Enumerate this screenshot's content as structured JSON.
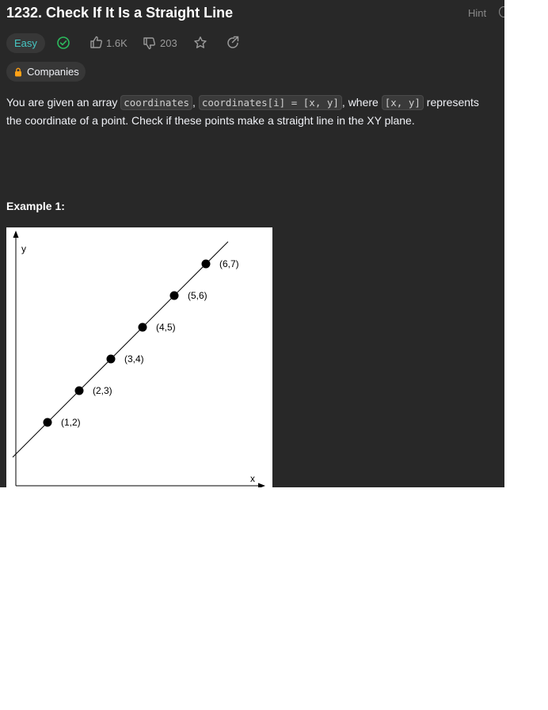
{
  "problem": {
    "title": "1232. Check If It Is a Straight Line",
    "hint_label": "Hint",
    "difficulty": "Easy",
    "likes": "1.6K",
    "dislikes": "203",
    "companies_label": "Companies",
    "colors": {
      "easy": "#46c6c2",
      "solved": "#2cbb5d",
      "panel_bg": "#282828"
    }
  },
  "description": {
    "text_1": "You are given an array ",
    "code_1": "coordinates",
    "text_2": ", ",
    "code_2": "coordinates[i] = [x, y]",
    "text_3": ", where ",
    "code_3": "[x, y]",
    "text_4": " represents the coordinate of a point. Check if these points make a straight line in the XY plane."
  },
  "example": {
    "heading": "Example 1:"
  },
  "chart_data": {
    "type": "scatter",
    "xlabel": "x",
    "ylabel": "y",
    "points": [
      {
        "x": 1,
        "y": 2,
        "label": "(1,2)"
      },
      {
        "x": 2,
        "y": 3,
        "label": "(2,3)"
      },
      {
        "x": 3,
        "y": 4,
        "label": "(3,4)"
      },
      {
        "x": 4,
        "y": 5,
        "label": "(4,5)"
      },
      {
        "x": 5,
        "y": 6,
        "label": "(5,6)"
      },
      {
        "x": 6,
        "y": 7,
        "label": "(6,7)"
      }
    ],
    "line": {
      "slope": 1,
      "intercept": 1
    },
    "grid": false
  }
}
